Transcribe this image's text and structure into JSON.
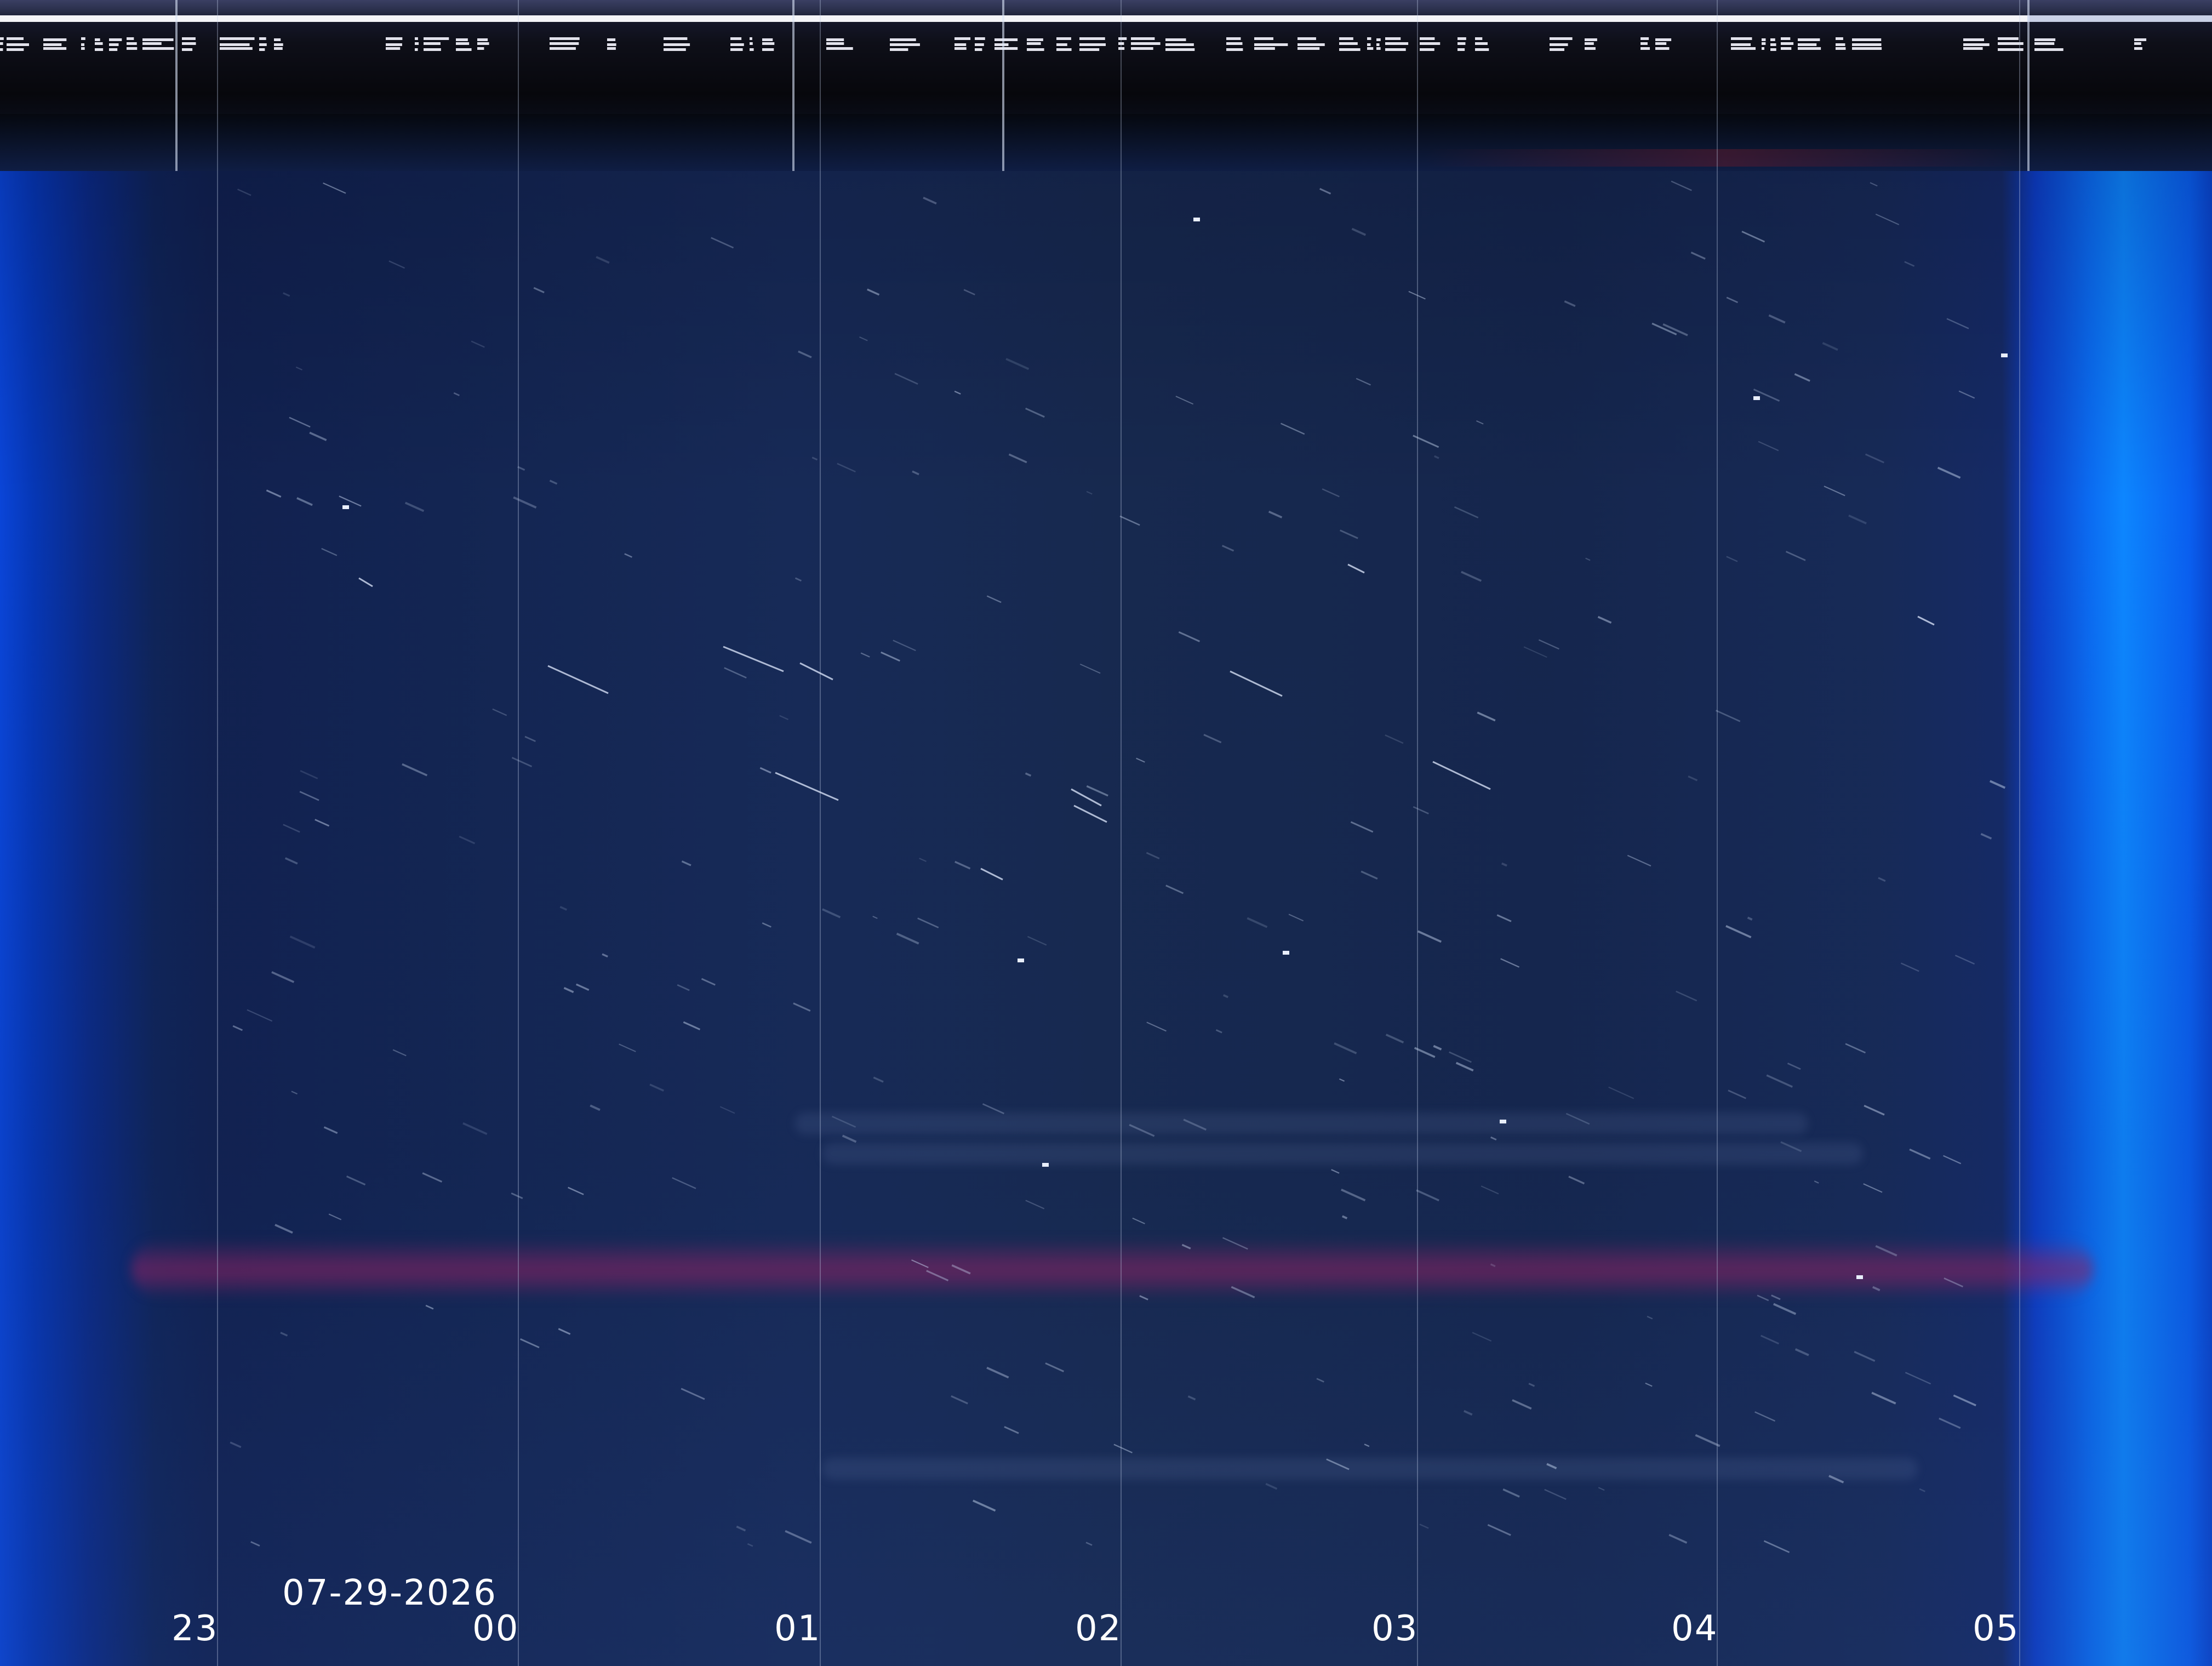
{
  "image": {
    "kind": "keogram / all-sky camera night composite",
    "date_label": "07-29-2026",
    "hour_labels": [
      "23",
      "00",
      "01",
      "02",
      "03",
      "04",
      "05"
    ]
  },
  "colors": {
    "sky": "#16294f",
    "edge_blue": "#0b6cf2",
    "red_band": "#8c2364",
    "header": "#0e0f18",
    "text": "#ffffff"
  }
}
